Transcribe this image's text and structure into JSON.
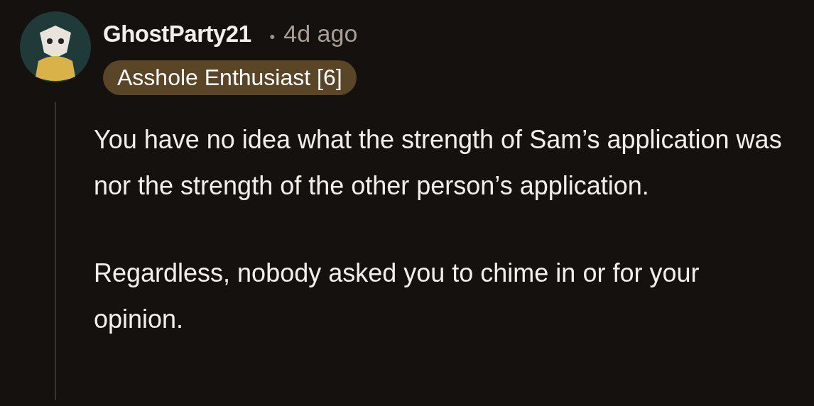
{
  "comment": {
    "username": "GhostParty21",
    "separator": "•",
    "time": "4d ago",
    "flair": {
      "text": "Asshole Enthusiast [6]",
      "color": "#5b4527"
    },
    "paragraphs": [
      "You have no idea what the strength of Sam’s application was nor the strength of the other person’s application.",
      "Regardless, nobody asked you to chime in or for your opinion."
    ]
  }
}
